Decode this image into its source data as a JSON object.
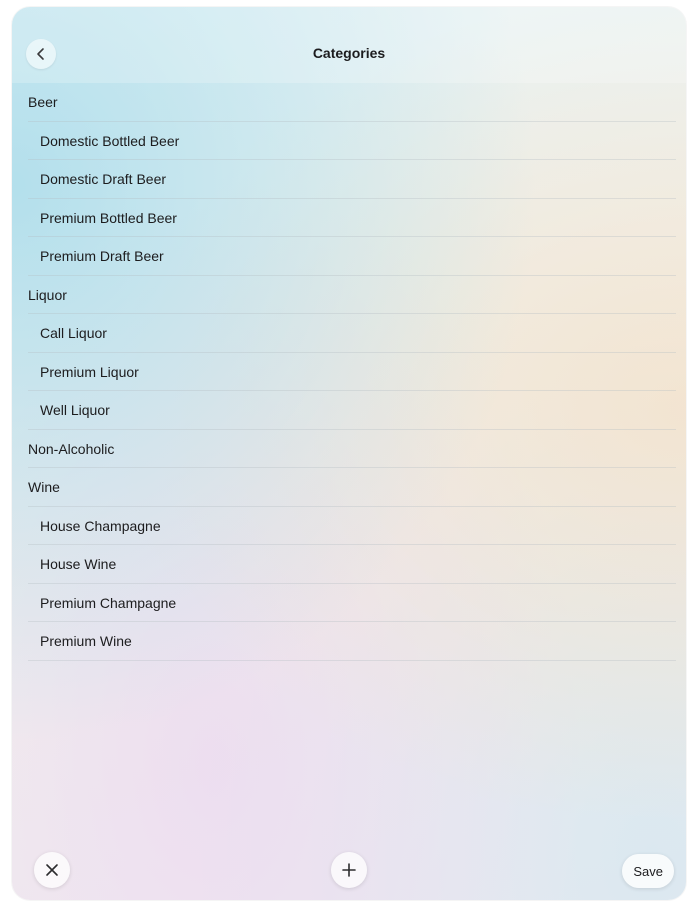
{
  "header": {
    "title": "Categories",
    "back_icon": "chevron-left-icon"
  },
  "categories": [
    {
      "label": "Beer",
      "level": 0
    },
    {
      "label": "Domestic Bottled Beer",
      "level": 1
    },
    {
      "label": "Domestic Draft Beer",
      "level": 1
    },
    {
      "label": "Premium Bottled Beer",
      "level": 1
    },
    {
      "label": "Premium Draft Beer",
      "level": 1
    },
    {
      "label": "Liquor",
      "level": 0
    },
    {
      "label": "Call Liquor",
      "level": 1
    },
    {
      "label": "Premium Liquor",
      "level": 1
    },
    {
      "label": "Well Liquor",
      "level": 1
    },
    {
      "label": "Non-Alcoholic",
      "level": 0
    },
    {
      "label": "Wine",
      "level": 0
    },
    {
      "label": "House Champagne",
      "level": 1
    },
    {
      "label": "House Wine",
      "level": 1
    },
    {
      "label": "Premium Champagne",
      "level": 1
    },
    {
      "label": "Premium Wine",
      "level": 1
    }
  ],
  "toolbar": {
    "close_icon": "close-icon",
    "add_icon": "plus-icon",
    "save_label": "Save"
  },
  "colors": {
    "text": "#1c1c1e",
    "gradient_teal": "#aadceb",
    "gradient_peach": "#f5e1c8",
    "gradient_lilac": "#ebd7f0"
  }
}
